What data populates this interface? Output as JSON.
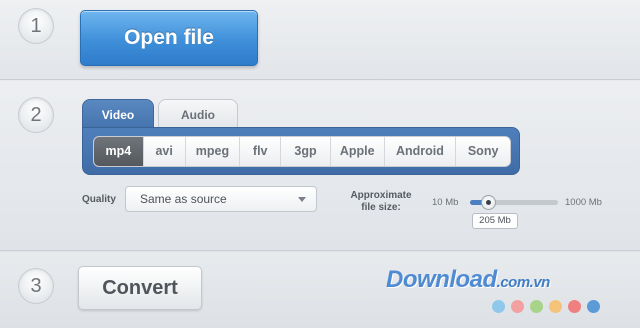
{
  "steps": {
    "one": "1",
    "two": "2",
    "three": "3"
  },
  "open_file": {
    "label": "Open file"
  },
  "tabs": [
    {
      "label": "Video",
      "active": true
    },
    {
      "label": "Audio",
      "active": false
    }
  ],
  "formats": [
    {
      "label": "mp4",
      "active": true
    },
    {
      "label": "avi",
      "active": false
    },
    {
      "label": "mpeg",
      "active": false
    },
    {
      "label": "flv",
      "active": false
    },
    {
      "label": "3gp",
      "active": false
    },
    {
      "label": "Apple",
      "active": false
    },
    {
      "label": "Android",
      "active": false
    },
    {
      "label": "Sony",
      "active": false
    }
  ],
  "quality": {
    "label": "Quality",
    "selected": "Same as source"
  },
  "file_size": {
    "label": "Approximate file size:",
    "min": "10 Mb",
    "max": "1000 Mb",
    "current": "205 Mb",
    "slider_fraction": 0.2
  },
  "convert": {
    "label": "Convert"
  },
  "watermark": {
    "text": "Download",
    "suffix": ".com.vn",
    "dot_colors": [
      "#8fc8ea",
      "#f2a0a0",
      "#a8d48a",
      "#f5c27a",
      "#f08080",
      "#5b9bd8"
    ]
  },
  "colors": {
    "accent": "#3f8fd9",
    "tab_active": "#4f7fbb"
  }
}
